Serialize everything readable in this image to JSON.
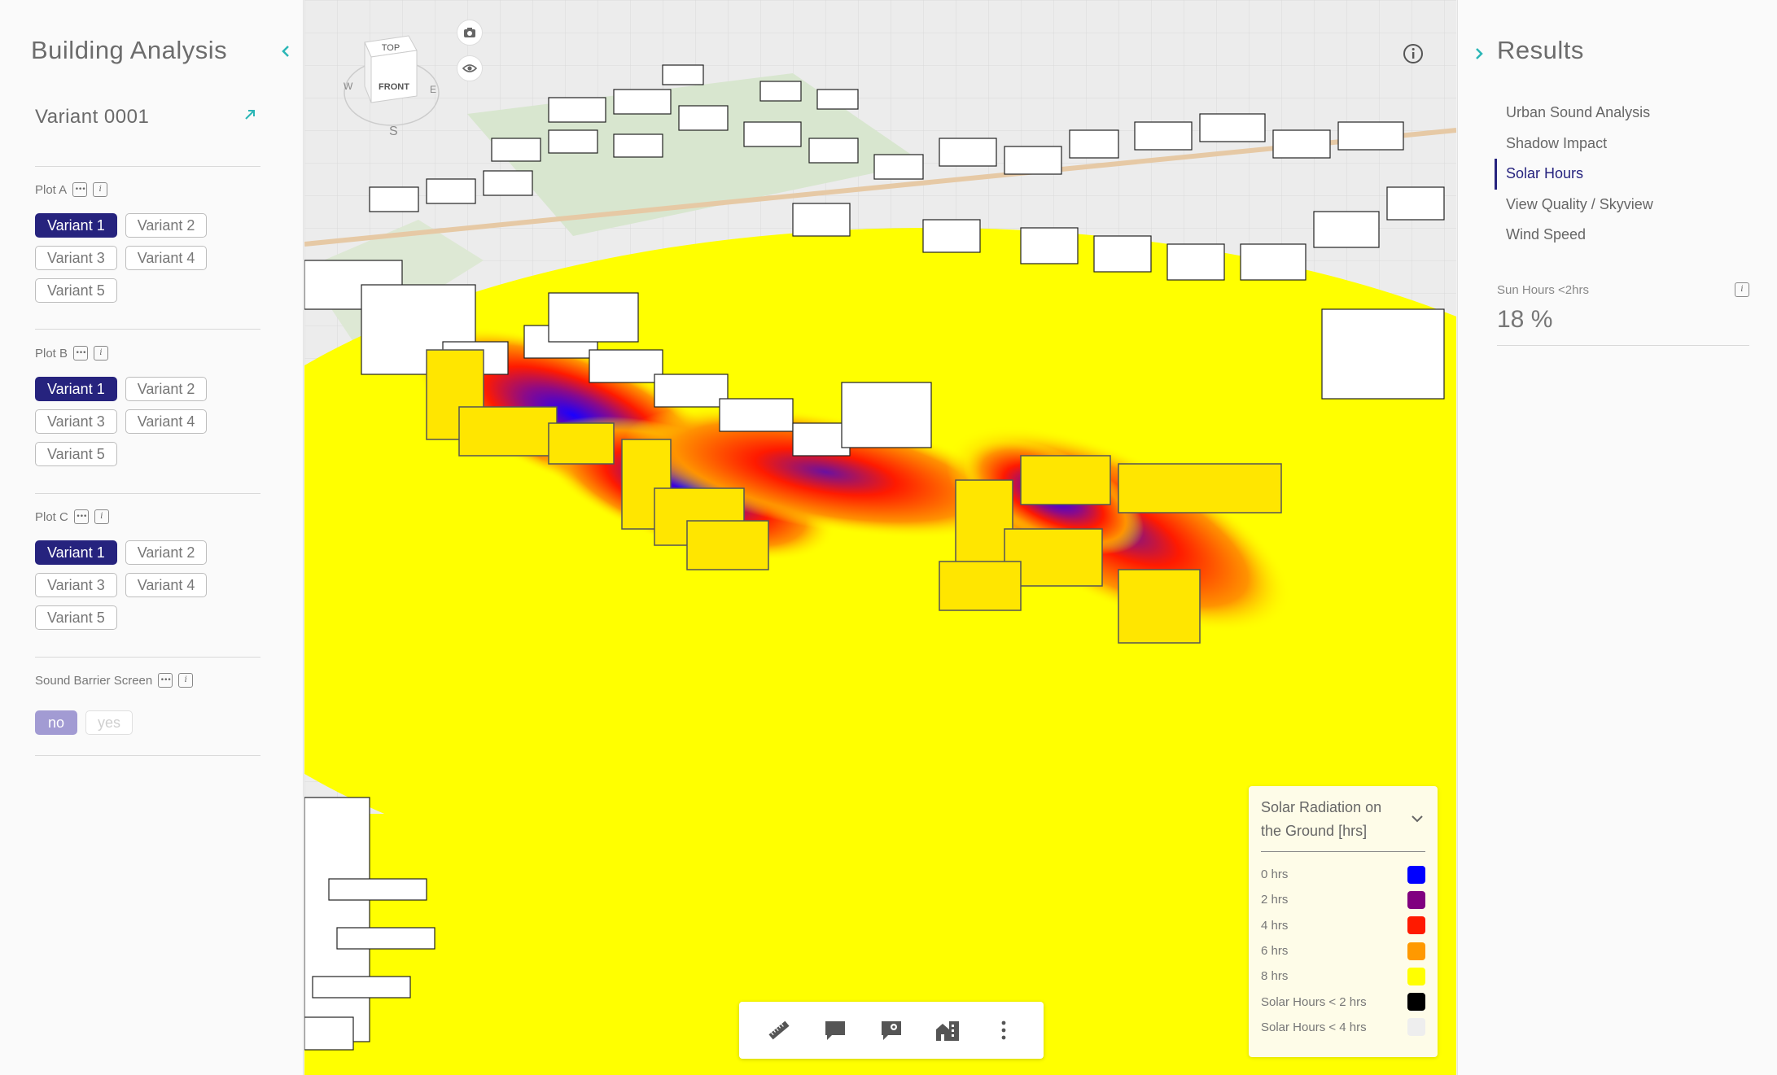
{
  "left_panel": {
    "title": "Building Analysis",
    "variant_name": "Variant 0001",
    "plots": [
      {
        "label": "Plot A",
        "variants": [
          "Variant 1",
          "Variant 2",
          "Variant 3",
          "Variant 4",
          "Variant 5"
        ],
        "selected": 0
      },
      {
        "label": "Plot B",
        "variants": [
          "Variant 1",
          "Variant 2",
          "Variant 3",
          "Variant 4",
          "Variant 5"
        ],
        "selected": 0
      },
      {
        "label": "Plot C",
        "variants": [
          "Variant 1",
          "Variant 2",
          "Variant 3",
          "Variant 4",
          "Variant 5"
        ],
        "selected": 0
      }
    ],
    "sound_barrier": {
      "label": "Sound Barrier Screen",
      "options": [
        "no",
        "yes"
      ],
      "selected": "no"
    }
  },
  "viewport": {
    "nav_cube": {
      "top": "TOP",
      "front": "FRONT",
      "west": "W",
      "east": "E",
      "south": "S"
    }
  },
  "legend": {
    "title": "Solar Radiation on the Ground [hrs]",
    "items": [
      {
        "label": "0 hrs",
        "color": "#0000ff"
      },
      {
        "label": "2 hrs",
        "color": "#800080"
      },
      {
        "label": "4 hrs",
        "color": "#ff1a00"
      },
      {
        "label": "6 hrs",
        "color": "#ff9900"
      },
      {
        "label": "8 hrs",
        "color": "#ffff00"
      },
      {
        "label": "Solar Hours < 2 hrs",
        "color": "#000000"
      },
      {
        "label": "Solar Hours < 4 hrs",
        "color": "#eeeeee"
      }
    ]
  },
  "toolbar": {
    "icons": [
      "ruler-icon",
      "comment-icon",
      "location-comment-icon",
      "building-icon",
      "more-vertical-icon"
    ]
  },
  "right_panel": {
    "title": "Results",
    "items": [
      "Urban Sound Analysis",
      "Shadow Impact",
      "Solar Hours",
      "View Quality / Skyview",
      "Wind Speed"
    ],
    "active_item": "Solar Hours",
    "metric": {
      "label": "Sun Hours <2hrs",
      "value": "18 %"
    }
  },
  "colors": {
    "accent": "#26237e",
    "teal": "#2bb6b6",
    "toggle_on": "#a29bd3"
  }
}
